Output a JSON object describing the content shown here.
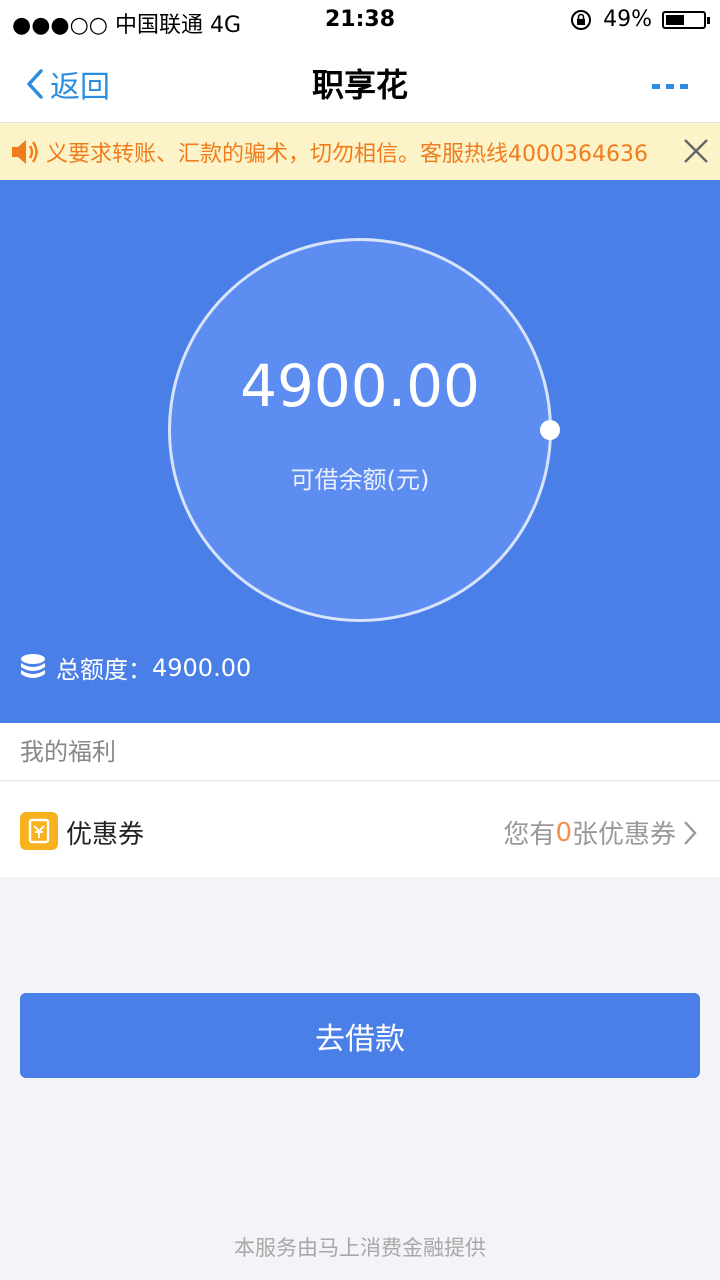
{
  "status_bar": {
    "carrier": "●●●○○ 中国联通   4G",
    "time": "21:38",
    "battery": "49%",
    "battery_level": 0.49
  },
  "nav": {
    "back_label": "返回",
    "title": "职享花"
  },
  "notice": {
    "text": "义要求转账、汇款的骗术，切勿相信。客服热线4000364636"
  },
  "hero": {
    "amount": "4900.00",
    "amount_label": "可借余额(元)",
    "total_label": "总额度：",
    "total_value": "4900.00"
  },
  "benefits": {
    "section_title": "我的福利",
    "coupon_label": "优惠券",
    "coupon_prefix": "您有",
    "coupon_count": "0",
    "coupon_suffix": "张优惠券"
  },
  "actions": {
    "borrow_label": "去借款"
  },
  "footer": {
    "text": "本服务由马上消费金融提供"
  },
  "colors": {
    "primary": "#4b7fe8",
    "link": "#2b8de0",
    "notice_text": "#ef7d1d",
    "notice_bg": "#fdf3c8",
    "highlight": "#f3904a"
  }
}
